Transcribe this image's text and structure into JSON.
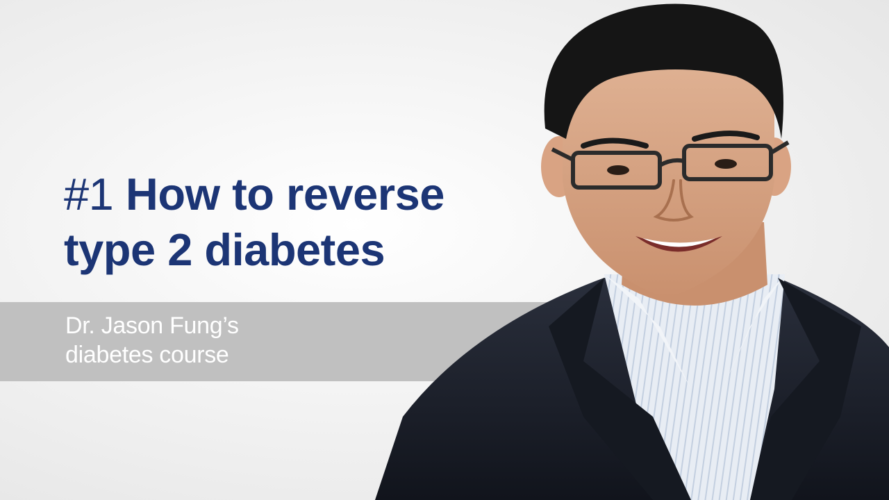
{
  "headline": {
    "number": "#1",
    "line1": "How to reverse",
    "line2": "type 2 diabetes"
  },
  "subtitle": {
    "line1": "Dr. Jason Fung’s",
    "line2": "diabetes course"
  },
  "colors": {
    "headline": "#1c3575",
    "band": "#c0c0c0",
    "subtitle": "#ffffff",
    "jacket": "#1b1f2a",
    "shirt": "#e6ecf3"
  }
}
